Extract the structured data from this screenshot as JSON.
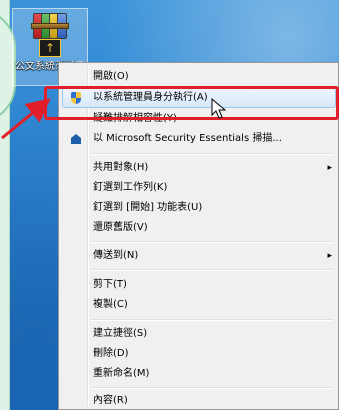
{
  "desktop_icon": {
    "label": "公文系統憑證安裝工具",
    "icon": "winrar-installer-icon"
  },
  "context_menu": {
    "items": [
      {
        "label": "開啟(O)",
        "icon": null,
        "submenu": false
      },
      {
        "label": "以系統管理員身分執行(A)",
        "icon": "uac-shield-icon",
        "submenu": false,
        "highlighted": true
      },
      {
        "label": "疑難排解相容性(Y)",
        "icon": null,
        "submenu": false
      },
      {
        "label": "以 Microsoft Security Essentials 掃描...",
        "icon": "mse-icon",
        "submenu": false
      },
      {
        "label": "共用對象(H)",
        "icon": null,
        "submenu": true
      },
      {
        "label": "釘選到工作列(K)",
        "icon": null,
        "submenu": false
      },
      {
        "label": "釘選到 [開始] 功能表(U)",
        "icon": null,
        "submenu": false
      },
      {
        "label": "還原舊版(V)",
        "icon": null,
        "submenu": false
      },
      {
        "label": "傳送到(N)",
        "icon": null,
        "submenu": true
      },
      {
        "label": "剪下(T)",
        "icon": null,
        "submenu": false
      },
      {
        "label": "複製(C)",
        "icon": null,
        "submenu": false
      },
      {
        "label": "建立捷徑(S)",
        "icon": null,
        "submenu": false
      },
      {
        "label": "刪除(D)",
        "icon": null,
        "submenu": false
      },
      {
        "label": "重新命名(M)",
        "icon": null,
        "submenu": false
      },
      {
        "label": "內容(R)",
        "icon": null,
        "submenu": false
      }
    ]
  },
  "colors": {
    "annotation_red": "#e11e2a",
    "menu_bg": "#f0f0f0",
    "desktop_blue": "#2f86d2",
    "left_panel": "#dff2e6"
  }
}
